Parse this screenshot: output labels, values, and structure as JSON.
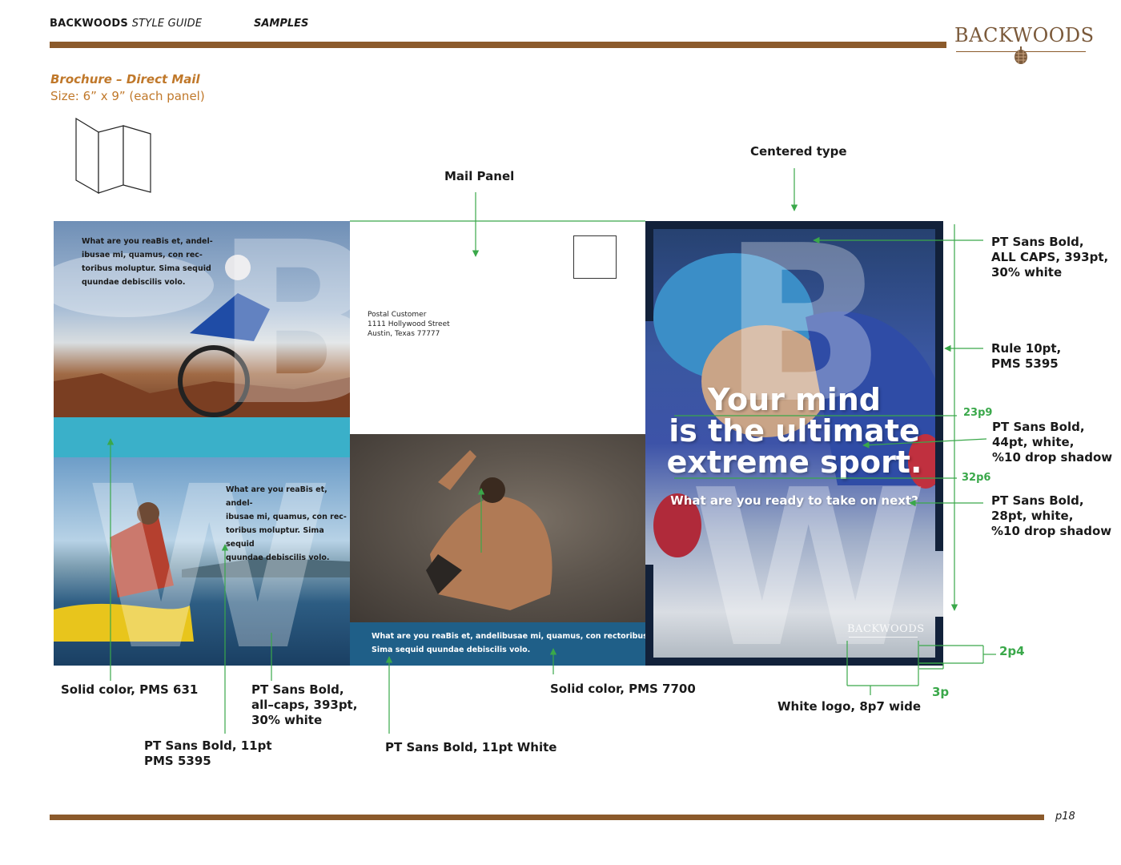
{
  "header": {
    "brand": "BACKWOODS",
    "guide": "STYLE GUIDE",
    "section": "SAMPLES",
    "logo_text": "BACKWOODS",
    "page": "p18"
  },
  "section": {
    "title": "Brochure – Direct Mail",
    "size": "Size: 6” x 9” (each panel)"
  },
  "panels": {
    "bike_text": [
      "What are you reaBis et, andel-",
      "ibusae mi, quamus, con rec-",
      "toribus moluptur. Sima sequid",
      "quundae debiscilis volo."
    ],
    "bike_letter": "B",
    "kayak_text": [
      "What are you reaBis et, andel-",
      "ibusae mi, quamus, con rec-",
      "toribus moluptur. Sima sequid",
      "quundae debiscilis volo."
    ],
    "kayak_letter": "W",
    "mail_address": [
      "Postal Customer",
      "1111 Hollywood Street",
      "Austin, Texas  77777"
    ],
    "climb_text": [
      "What are you reaBis et, andelibusae mi, quamus, con rectoribus moluptur.",
      "Sima sequid quundae debiscilis volo."
    ],
    "cover_letter_top": "B",
    "cover_letter_bottom": "W",
    "cover_headline": [
      "Your mind",
      "is the ultimate",
      "extreme sport."
    ],
    "cover_sub": "What are you ready to take on next?",
    "cover_logo": "BACKWOODS"
  },
  "annotations": {
    "mail_panel": "Mail Panel",
    "centered_type": "Centered type",
    "caps": [
      "PT Sans Bold,",
      "ALL CAPS, 393pt,",
      "30% white"
    ],
    "rule": [
      "Rule 10pt,",
      "PMS 5395"
    ],
    "h44": [
      "PT Sans Bold,",
      "44pt, white,",
      "%10 drop shadow"
    ],
    "h28": [
      "PT Sans Bold,",
      "28pt, white,",
      "%10 drop shadow"
    ],
    "m23p9": "23p9",
    "m32p6": "32p6",
    "m2p4": "2p4",
    "m3p": "3p",
    "white_logo": "White logo, 8p7 wide",
    "solid631": "Solid color, PMS 631",
    "allcaps393": [
      "PT Sans Bold,",
      "all–caps, 393pt,",
      "30% white"
    ],
    "pt11": [
      "PT Sans Bold, 11pt",
      "PMS 5395"
    ],
    "pt11white": "PT Sans Bold, 11pt White",
    "solid7700": "Solid color, PMS 7700"
  },
  "colors": {
    "brown": "#8b5a2b",
    "orange": "#c0782a",
    "teal": "#3ab0c9",
    "blue": "#1f5f88",
    "green": "#3aa84a"
  }
}
